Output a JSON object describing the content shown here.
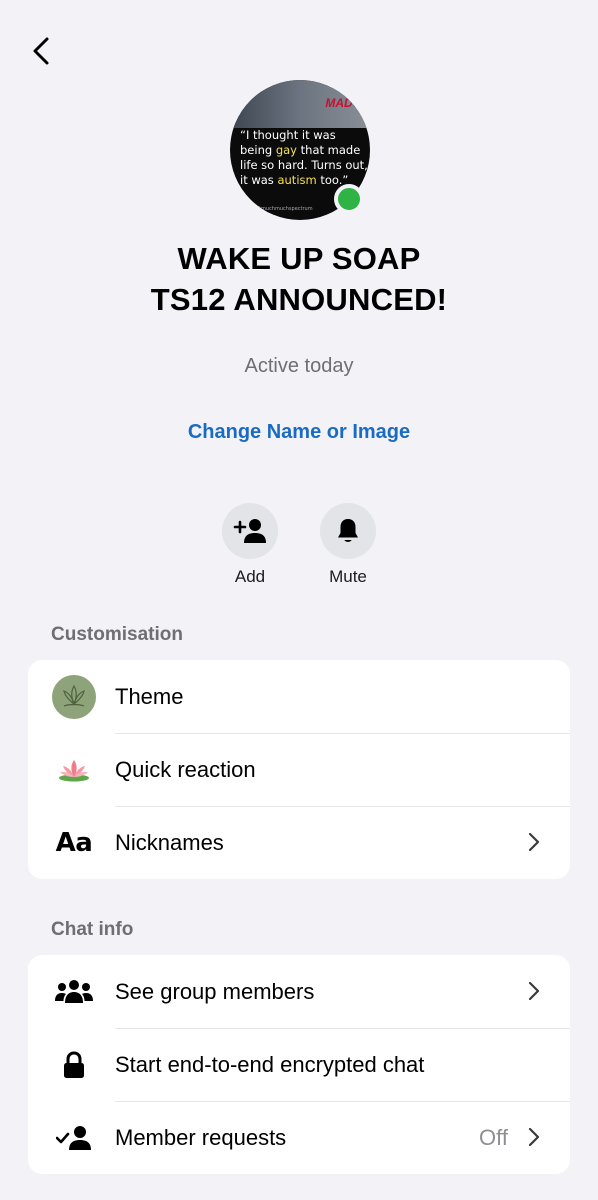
{
  "header": {
    "back_icon": "chevron-left-icon"
  },
  "profile": {
    "avatar_brand": "MADO",
    "avatar_quote_1": "“I thought it was being ",
    "avatar_quote_hl1": "gay",
    "avatar_quote_2": " that made life so hard. Turns out, it was ",
    "avatar_quote_hl2": "autism",
    "avatar_quote_3": " too.”",
    "avatar_handle": "@muchmuchspectrum",
    "online_color": "#2fb344",
    "name_line1": "WAKE UP SOAP",
    "name_line2": "TS12 ANNOUNCED!",
    "status": "Active today",
    "change_link": "Change Name or Image",
    "link_color": "#1a6bc4"
  },
  "actions": [
    {
      "label": "Add",
      "icon": "add-person-icon"
    },
    {
      "label": "Mute",
      "icon": "bell-icon"
    }
  ],
  "customisation": {
    "title": "Customisation",
    "items": [
      {
        "label": "Theme",
        "icon": "theme-swatch-icon"
      },
      {
        "label": "Quick reaction",
        "icon": "lotus-icon",
        "emoji": "🪷"
      },
      {
        "label": "Nicknames",
        "icon": "text-aa-icon",
        "icon_text": "Aa"
      }
    ]
  },
  "chat_info": {
    "title": "Chat info",
    "items": [
      {
        "label": "See group members",
        "icon": "people-icon"
      },
      {
        "label": "Start end-to-end encrypted chat",
        "icon": "lock-icon"
      },
      {
        "label": "Member requests",
        "icon": "person-check-icon",
        "value": "Off"
      }
    ]
  }
}
